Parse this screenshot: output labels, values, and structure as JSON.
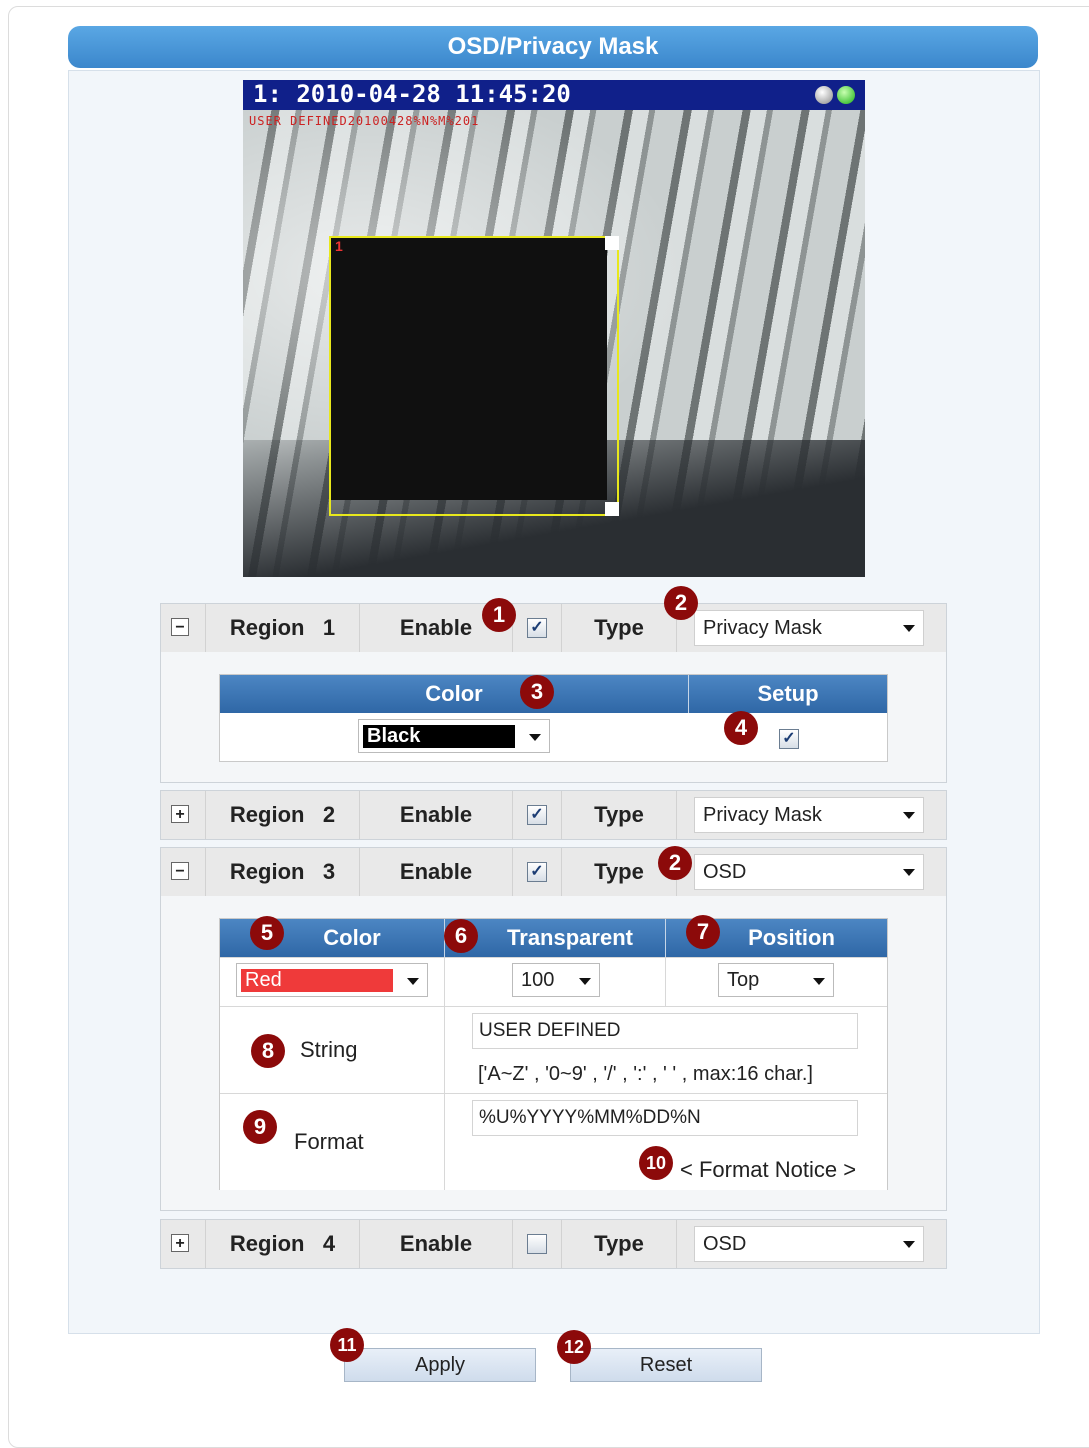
{
  "page": {
    "title": "OSD/Privacy Mask"
  },
  "video": {
    "timestamp": "1:  2010-04-28 11:45:20",
    "osd_text": "USER DEFINED20100428%N%M%201",
    "mask_label": "1"
  },
  "regions": [
    {
      "label": "Region",
      "number": "1",
      "enable_label": "Enable",
      "enabled": true,
      "type_label": "Type",
      "type_value": "Privacy Mask",
      "expanded": true
    },
    {
      "label": "Region",
      "number": "2",
      "enable_label": "Enable",
      "enabled": true,
      "type_label": "Type",
      "type_value": "Privacy Mask",
      "expanded": false
    },
    {
      "label": "Region",
      "number": "3",
      "enable_label": "Enable",
      "enabled": true,
      "type_label": "Type",
      "type_value": "OSD",
      "expanded": true
    },
    {
      "label": "Region",
      "number": "4",
      "enable_label": "Enable",
      "enabled": false,
      "type_label": "Type",
      "type_value": "OSD",
      "expanded": false
    }
  ],
  "region1_detail": {
    "color_header": "Color",
    "setup_header": "Setup",
    "color_value": "Black",
    "color_swatch": "#000000",
    "setup_checked": true
  },
  "region3_detail": {
    "color_header": "Color",
    "transparent_header": "Transparent",
    "position_header": "Position",
    "color_value": "Red",
    "color_swatch": "#ef3a3a",
    "transparent_value": "100",
    "position_value": "Top",
    "string_label": "String",
    "string_value": "USER DEFINED",
    "string_hint": "['A~Z' , '0~9' , '/' , ':' , ' ' , max:16 char.]",
    "format_label": "Format",
    "format_value": "%U%YYYY%MM%DD%N",
    "format_notice": "< Format Notice >"
  },
  "badges": [
    "1",
    "2",
    "3",
    "4",
    "2",
    "5",
    "6",
    "7",
    "8",
    "9",
    "10",
    "11",
    "12"
  ],
  "buttons": {
    "apply": "Apply",
    "reset": "Reset"
  },
  "colors": {
    "title_bar": "#4a98dc",
    "table_header": "#3a72b0",
    "badge": "#8c0a0a"
  }
}
